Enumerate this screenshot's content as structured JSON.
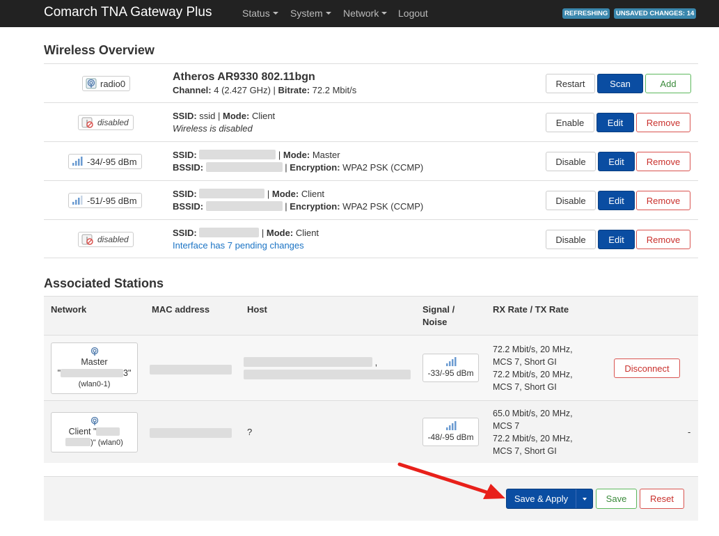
{
  "navbar": {
    "brand": "Comarch TNA Gateway Plus",
    "menu": [
      "Status",
      "System",
      "Network",
      "Logout"
    ],
    "badges": [
      "REFRESHING",
      "UNSAVED CHANGES: 14"
    ],
    "badge_color": "#3a87ad"
  },
  "wireless": {
    "title": "Wireless Overview",
    "radio": {
      "badge": "radio0",
      "icon": "wifi-icon",
      "name": "Atheros AR9330 802.11bgn",
      "channel_label": "Channel:",
      "channel_value": "4 (2.427 GHz)",
      "bitrate_label": "Bitrate:",
      "bitrate_value": "72.2 Mbit/s",
      "buttons": [
        "Restart",
        "Scan",
        "Add"
      ]
    },
    "rows": [
      {
        "badge": "disabled",
        "icon": "wifi-disabled-icon",
        "line1": {
          "ssid_label": "SSID:",
          "ssid": "ssid",
          "mode_label": "Mode:",
          "mode": "Client"
        },
        "line2_text": "Wireless is disabled",
        "buttons": [
          "Enable",
          "Edit",
          "Remove"
        ]
      },
      {
        "badge": "-34/-95 dBm",
        "icon": "signal-icon",
        "line1": {
          "ssid_label": "SSID:",
          "mode_label": "Mode:",
          "mode": "Master"
        },
        "line2": {
          "bssid_label": "BSSID:",
          "enc_label": "Encryption:",
          "enc": "WPA2 PSK (CCMP)"
        },
        "buttons": [
          "Disable",
          "Edit",
          "Remove"
        ]
      },
      {
        "badge": "-51/-95 dBm",
        "icon": "signal-icon",
        "line1": {
          "ssid_label": "SSID:",
          "mode_label": "Mode:",
          "mode": "Client"
        },
        "line2": {
          "bssid_label": "BSSID:",
          "enc_label": "Encryption:",
          "enc": "WPA2 PSK (CCMP)"
        },
        "buttons": [
          "Disable",
          "Edit",
          "Remove"
        ]
      },
      {
        "badge": "disabled",
        "icon": "wifi-disabled-icon",
        "line1": {
          "ssid_label": "SSID:",
          "mode_label": "Mode:",
          "mode": "Client"
        },
        "line2_link": "Interface has 7 pending changes",
        "buttons": [
          "Disable",
          "Edit",
          "Remove"
        ]
      }
    ]
  },
  "stations": {
    "title": "Associated Stations",
    "headers": {
      "network": "Network",
      "mac": "MAC address",
      "host": "Host",
      "signal_1": "Signal /",
      "signal_2": "Noise",
      "rate": "RX Rate / TX Rate"
    },
    "rows": [
      {
        "net_line1": "Master",
        "net_line2_prefix": "\"",
        "net_line2_suffix": "3\"",
        "net_line3": "(wlan0-1)",
        "host_comma": ",",
        "signal": "-33/-95 dBm",
        "rate_lines": [
          "72.2 Mbit/s, 20 MHz,",
          "MCS 7, Short GI",
          "72.2 Mbit/s, 20 MHz,",
          "MCS 7, Short GI"
        ],
        "action": "Disconnect"
      },
      {
        "net_line1": "Client \"",
        "net_line2": ")\" (wlan0)",
        "host": "?",
        "signal": "-48/-95 dBm",
        "rate_lines": [
          "65.0 Mbit/s, 20 MHz,",
          "MCS 7",
          "72.2 Mbit/s, 20 MHz,",
          "MCS 7, Short GI"
        ],
        "action": "-"
      }
    ]
  },
  "actions": {
    "save_apply": "Save & Apply",
    "save": "Save",
    "reset": "Reset"
  }
}
